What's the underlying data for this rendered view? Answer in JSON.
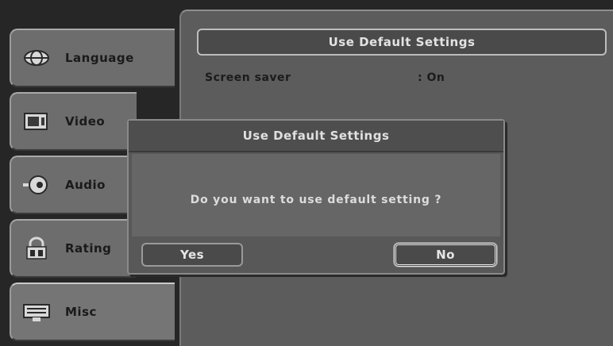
{
  "panel": {
    "title": "Use Default Settings",
    "setting_label": "Screen saver",
    "setting_value": ": On"
  },
  "sidebar": {
    "items": [
      {
        "label": "Language",
        "icon": "language-icon"
      },
      {
        "label": "Video",
        "icon": "video-icon"
      },
      {
        "label": "Audio",
        "icon": "audio-icon"
      },
      {
        "label": "Rating",
        "icon": "rating-lock-icon"
      },
      {
        "label": "Misc",
        "icon": "misc-icon",
        "active": true
      }
    ]
  },
  "dialog": {
    "title": "Use Default Settings",
    "message": "Do you want to use default setting ?",
    "yes_label": "Yes",
    "no_label": "No",
    "selected": "No"
  }
}
